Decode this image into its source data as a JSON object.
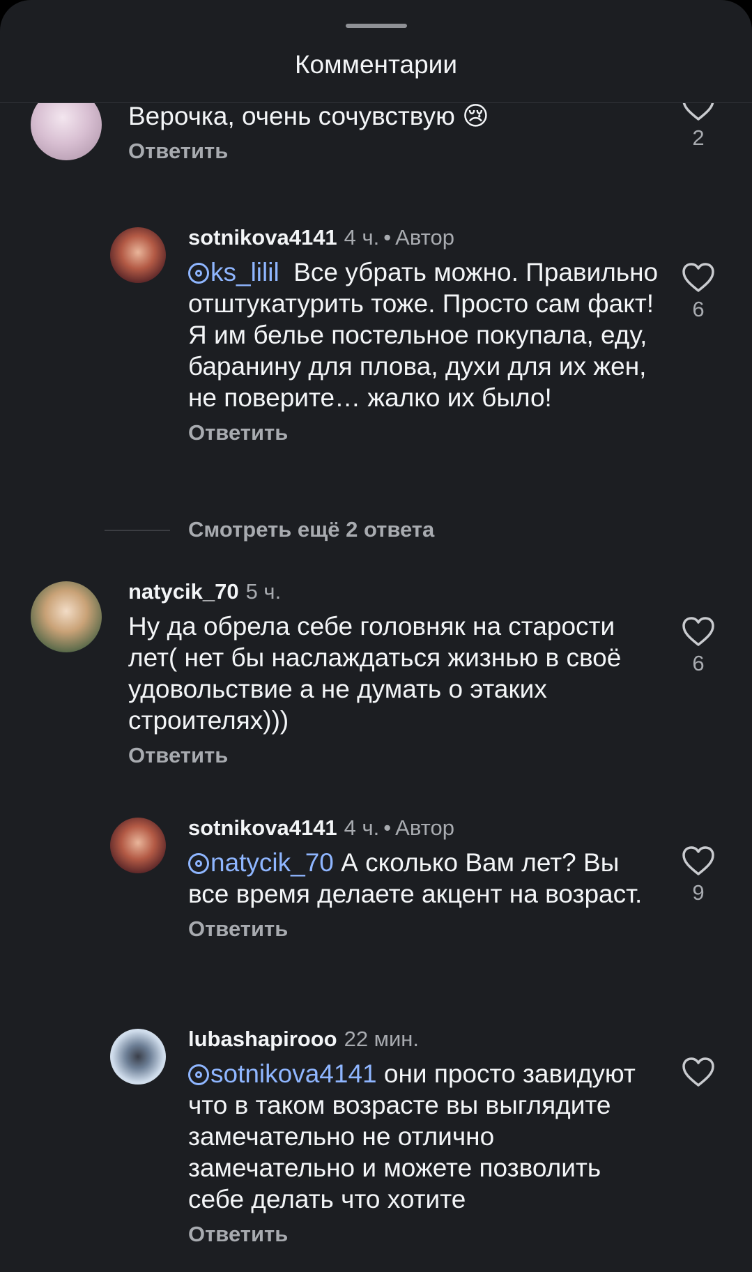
{
  "header": {
    "title": "Комментарии"
  },
  "comments": [
    {
      "username": "",
      "time": "",
      "author_badge": "",
      "mention": "",
      "text": "Верочка, очень сочувствую 😢",
      "reply_label": "Ответить",
      "likes": "2",
      "avatar_color": "#d9c2d6"
    },
    {
      "username": "sotnikova4141",
      "time": "4 ч.",
      "author_badge": "Автор",
      "mention": "ks_lilil",
      "text": "Все убрать можно. Правильно отштукатурить тоже. Просто сам факт! Я им белье постельное покупала, еду, баранину для плова, духи для их жен, не поверите… жалко их было!",
      "reply_label": "Ответить",
      "likes": "6",
      "avatar_color": "#7a3b3a"
    },
    {
      "username": "natycik_70",
      "time": "5 ч.",
      "author_badge": "",
      "mention": "",
      "text": "Ну да обрела себе головняк на старости лет( нет бы наслаждаться жизнью в своё удовольствие а не думать о этаких строителях)))",
      "reply_label": "Ответить",
      "likes": "6",
      "avatar_color": "#c9b38a"
    },
    {
      "username": "sotnikova4141",
      "time": "4 ч.",
      "author_badge": "Автор",
      "mention": "natycik_70",
      "text": "А сколько Вам лет? Вы все время делаете акцент на возраст.",
      "reply_label": "Ответить",
      "likes": "9",
      "avatar_color": "#7a3b3a"
    },
    {
      "username": "lubashapirooo",
      "time": "22 мин.",
      "author_badge": "",
      "mention": "sotnikova4141",
      "text": "они просто завидуют что в таком возрасте вы выглядите замечательно не отлично замечательно и можете позволить себе делать что хотите",
      "reply_label": "Ответить",
      "likes": "",
      "avatar_color": "#c8d6e4"
    }
  ],
  "view_more": "Смотреть ещё 2 ответа",
  "icons": {
    "like": "heart-outline-icon",
    "mention": "threads-at-icon"
  }
}
